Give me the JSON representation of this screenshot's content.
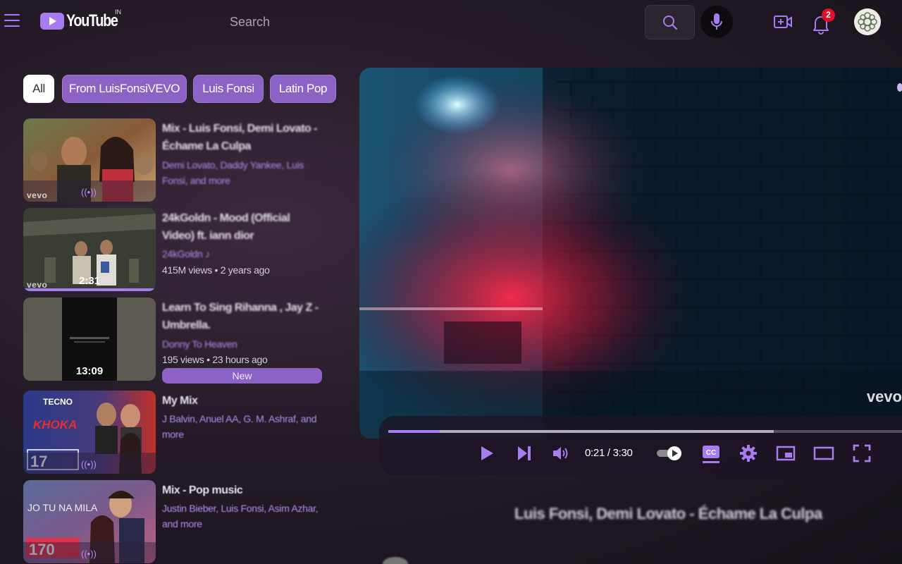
{
  "header": {
    "logo_text": "YouTube",
    "country_code": "IN",
    "search_placeholder": "Search",
    "notification_count": "2",
    "icons": [
      "menu-icon",
      "search-icon",
      "mic-icon",
      "create-icon",
      "bell-icon"
    ]
  },
  "chips": [
    {
      "label": "All",
      "active": true
    },
    {
      "label": "From LuisFonsiVEVO",
      "active": false
    },
    {
      "label": "Luis Fonsi",
      "active": false
    },
    {
      "label": "Latin Pop",
      "active": false
    }
  ],
  "videos": [
    {
      "title": "Mix - Luis Fonsi, Demi Lovato - Échame La Culpa",
      "channel": "Demi Lovato, Daddy Yankee, Luis Fonsi, and more",
      "badge": "vevo",
      "mix": true
    },
    {
      "title": "24kGoldn - Mood (Official Video) ft. iann dior",
      "channel": "24kGoldn ♪",
      "views": "415M views",
      "age": "2 years ago",
      "duration": "2:31",
      "badge": "vevo",
      "watched_fraction": 1.0
    },
    {
      "title": "Learn To Sing Rihanna , Jay Z - Umbrella.",
      "channel": "Donny To Heaven",
      "views": "195 views",
      "age": "23 hours ago",
      "duration": "13:09",
      "new_label": "New"
    },
    {
      "title": "My Mix",
      "channel": "J Balvin, Anuel AA, G. M. Ashraf, and more",
      "mix": true
    },
    {
      "title": "Mix - Pop music",
      "channel": "Justin Bieber, Luis Fonsi, Asim Azhar, and more",
      "mix": true
    }
  ],
  "player": {
    "current_time": "0:21",
    "total_time": "3:30",
    "time_display": "0:21 / 3:30",
    "played_fraction": 0.1,
    "buffered_fraction": 0.75,
    "watermark": "vevo",
    "now_playing_title": "Luis Fonsi, Demi Lovato - Échame La Culpa",
    "colors": {
      "accent": "#a77cf0",
      "badge_red": "#e0112b"
    }
  }
}
